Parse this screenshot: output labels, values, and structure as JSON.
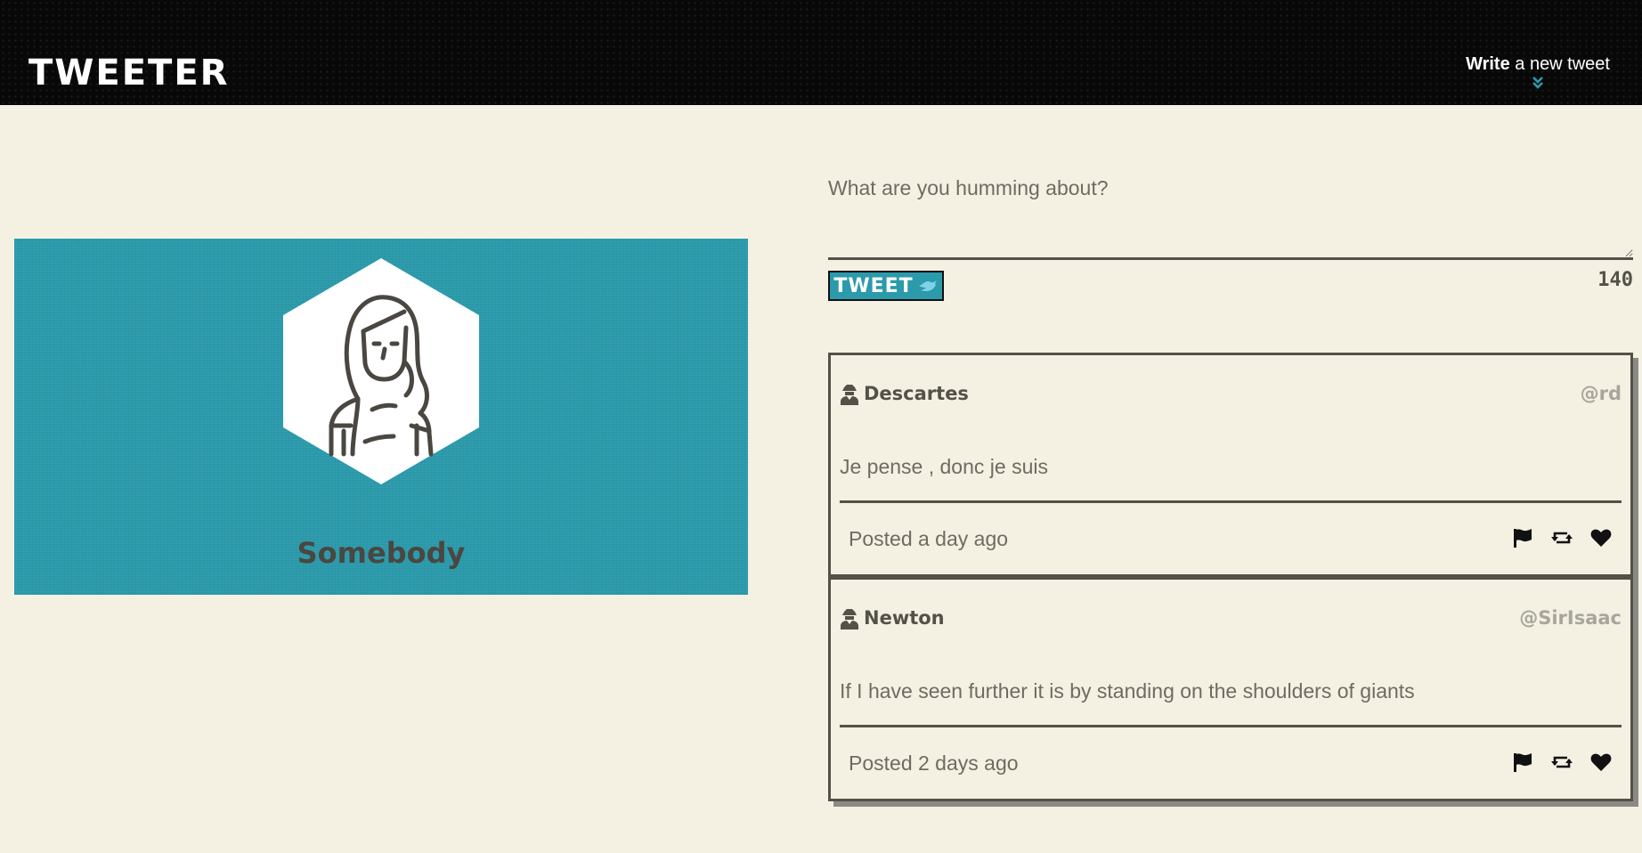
{
  "nav": {
    "logo": "TWEETER",
    "compose_bold": "Write",
    "compose_rest": " a new tweet",
    "chevron_icon": "double-chevron-down-icon"
  },
  "profile": {
    "name": "Somebody",
    "avatar_icon": "woman-avatar-icon",
    "background_color": "#2b9aab"
  },
  "compose": {
    "placeholder": "What are you humming about?",
    "value": "",
    "button_label": "TWEET",
    "button_icon": "bird-icon",
    "counter": "140"
  },
  "tweets": [
    {
      "author": "Descartes",
      "handle": "@rd",
      "text": "Je pense , donc je suis",
      "posted": "Posted a day ago",
      "actions": [
        "flag-icon",
        "retweet-icon",
        "heart-icon"
      ]
    },
    {
      "author": "Newton",
      "handle": "@SirIsaac",
      "text": "If I have seen further it is by standing on the shoulders of giants",
      "posted": "Posted 2 days ago",
      "actions": [
        "flag-icon",
        "retweet-icon",
        "heart-icon"
      ]
    }
  ],
  "colors": {
    "background": "#f4f1e3",
    "nav": "#080808",
    "accent": "#2b9aab",
    "text": "#545149"
  }
}
